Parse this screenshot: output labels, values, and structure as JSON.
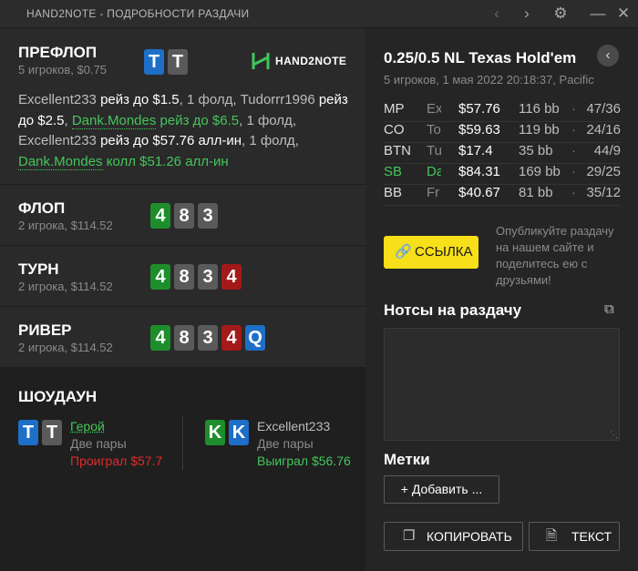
{
  "window": {
    "title": "HAND2NOTE - ПОДРОБНОСТИ РАЗДАЧИ",
    "icons": [
      "chevron-left-icon",
      "chevron-right-icon",
      "gear-icon",
      "minimize-icon",
      "close-icon"
    ]
  },
  "logo": {
    "text": "HAND2NOTE"
  },
  "preflop": {
    "title": "ПРЕФЛОП",
    "sub": "5 игроков, $0.75",
    "cards": [
      {
        "r": "T",
        "color": "#1e6fc8"
      },
      {
        "r": "T",
        "color": "#5a5a5a"
      }
    ],
    "log": [
      {
        "t": "Excellent233 ",
        "c": "n"
      },
      {
        "t": "рейз до $1.5",
        "c": "b"
      },
      {
        "t": ", 1 фолд, Tudorrr1996 ",
        "c": "n"
      },
      {
        "t": "рейз до $2.5",
        "c": "b"
      },
      {
        "t": ", ",
        "c": "n"
      },
      {
        "t": "Dank.Mondes",
        "c": "hu"
      },
      {
        "t": " рейз до $6.5",
        "c": "h"
      },
      {
        "t": ", 1 фолд, Excellent233 ",
        "c": "n"
      },
      {
        "t": "рейз до $57.76 алл-ин",
        "c": "b"
      },
      {
        "t": ", 1 фолд, ",
        "c": "n"
      },
      {
        "t": "Dank.Mondes",
        "c": "hu"
      },
      {
        "t": " колл $51.26 алл-ин",
        "c": "h"
      }
    ]
  },
  "streets": [
    {
      "title": "ФЛОП",
      "sub": "2 игрока, $114.52",
      "cards": [
        {
          "r": "4",
          "color": "#1e8e2c"
        },
        {
          "r": "8",
          "color": "#5a5a5a"
        },
        {
          "r": "3",
          "color": "#5a5a5a"
        }
      ]
    },
    {
      "title": "ТУРН",
      "sub": "2 игрока, $114.52",
      "cards": [
        {
          "r": "4",
          "color": "#1e8e2c"
        },
        {
          "r": "8",
          "color": "#5a5a5a"
        },
        {
          "r": "3",
          "color": "#5a5a5a"
        },
        {
          "r": "4",
          "color": "#a41919"
        }
      ]
    },
    {
      "title": "РИВЕР",
      "sub": "2 игрока, $114.52",
      "cards": [
        {
          "r": "4",
          "color": "#1e8e2c"
        },
        {
          "r": "8",
          "color": "#5a5a5a"
        },
        {
          "r": "3",
          "color": "#5a5a5a"
        },
        {
          "r": "4",
          "color": "#a41919"
        },
        {
          "r": "Q",
          "color": "#1e6fc8"
        }
      ]
    }
  ],
  "showdown": {
    "title": "ШОУДАУН",
    "players": [
      {
        "name": "Герой",
        "hand": "Две пары",
        "result": "Проиграл $57.7",
        "name_color": "#44c65a",
        "result_color": "#e02b2b",
        "cards": [
          {
            "r": "T",
            "color": "#1e6fc8"
          },
          {
            "r": "T",
            "color": "#5a5a5a"
          }
        ]
      },
      {
        "name": "Excellent233",
        "hand": "Две пары",
        "result": "Выиграл $56.76",
        "name_color": "#bdbdbd",
        "result_color": "#44c65a",
        "cards": [
          {
            "r": "K",
            "color": "#1e8e2c"
          },
          {
            "r": "K",
            "color": "#1e6fc8"
          }
        ]
      }
    ]
  },
  "game": {
    "title": "0.25/0.5 NL Texas Hold'em",
    "sub": "5 игроков, 1 мая 2022 20:18:37, Pacific",
    "players": [
      {
        "pos": "MP",
        "name": "Ex",
        "stack": "$57.76",
        "bb": "116 bb",
        "dot": "·",
        "stat": "47/36",
        "highlight": false
      },
      {
        "pos": "CO",
        "name": "To",
        "stack": "$59.63",
        "bb": "119 bb",
        "dot": "·",
        "stat": "24/16",
        "highlight": false
      },
      {
        "pos": "BTN",
        "name": "Tu",
        "stack": "$17.4",
        "bb": "35 bb",
        "dot": "·",
        "stat": "44/9",
        "highlight": false
      },
      {
        "pos": "SB",
        "name": "Da",
        "stack": "$84.31",
        "bb": "169 bb",
        "dot": "·",
        "stat": "29/25",
        "highlight": true
      },
      {
        "pos": "BB",
        "name": "Fr",
        "stack": "$40.67",
        "bb": "81 bb",
        "dot": "·",
        "stat": "35/12",
        "highlight": false
      }
    ],
    "highlight_color": "#44c65a"
  },
  "share": {
    "button": "ССЫЛКА",
    "promo": "Опубликуйте раздачу на нашем сайте и поделитесь ею с друзьями!"
  },
  "notes": {
    "title": "Нотсы на раздачу",
    "value": "",
    "placeholder": ""
  },
  "tags": {
    "title": "Метки",
    "add": "+ Добавить ..."
  },
  "actions": {
    "copy": "КОПИРОВАТЬ",
    "text": "ТЕКСТ"
  }
}
